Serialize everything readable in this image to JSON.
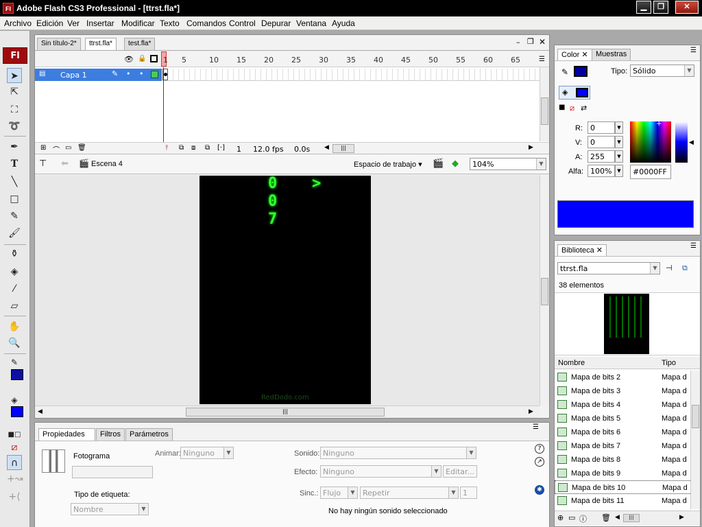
{
  "window": {
    "title": "Adobe Flash CS3 Professional - [ttrst.fla*]",
    "app_icon": "Fl"
  },
  "menu": [
    "Archivo",
    "Edición",
    "Ver",
    "Insertar",
    "Modificar",
    "Texto",
    "Comandos",
    "Control",
    "Depurar",
    "Ventana",
    "Ayuda"
  ],
  "doc_tabs": [
    "Sin título-2*",
    "ttrst.fla*",
    "test.fla*"
  ],
  "timeline": {
    "frame_numbers": [
      "1",
      "5",
      "10",
      "15",
      "20",
      "25",
      "30",
      "35",
      "40",
      "45",
      "50",
      "55",
      "60",
      "65"
    ],
    "layer_name": "Capa 1",
    "current_frame": "1",
    "fps": "12.0 fps",
    "time": "0.0s"
  },
  "editbar": {
    "scene": "Escena 4",
    "workspace": "Espacio de trabajo",
    "zoom": "104%"
  },
  "stage": {
    "glyphs": [
      "0",
      "0",
      "7",
      ">"
    ],
    "watermark": "RedDodo.com",
    "background": "#000000"
  },
  "props": {
    "tabs": [
      "Propiedades",
      "Filtros",
      "Parámetros"
    ],
    "frame_label": "Fotograma",
    "animate_label": "Animar:",
    "animate_value": "Ninguno",
    "label_type": "Tipo de etiqueta:",
    "label_type_value": "Nombre",
    "sound_label": "Sonido:",
    "sound_value": "Ninguno",
    "effect_label": "Efecto:",
    "effect_value": "Ninguno",
    "edit_button": "Editar...",
    "sync_label": "Sinc.:",
    "sync_value": "Flujo",
    "repeat_value": "Repetir",
    "repeat_count": "1",
    "no_sound": "No hay ningún sonido seleccionado"
  },
  "color": {
    "tabs": [
      "Color",
      "Muestras"
    ],
    "type_label": "Tipo:",
    "type_value": "Sólido",
    "r_label": "R:",
    "r": "0",
    "g_label": "V:",
    "g": "0",
    "b_label": "A:",
    "b": "255",
    "alpha_label": "Alfa:",
    "alpha": "100%",
    "hex": "#0000FF",
    "swatch": "#0000FF"
  },
  "library": {
    "tab": "Biblioteca",
    "file": "ttrst.fla",
    "count": "38 elementos",
    "col_name": "Nombre",
    "col_type": "Tipo",
    "items": [
      {
        "name": "Mapa de bits 2",
        "type": "Mapa d"
      },
      {
        "name": "Mapa de bits 3",
        "type": "Mapa d"
      },
      {
        "name": "Mapa de bits 4",
        "type": "Mapa d"
      },
      {
        "name": "Mapa de bits 5",
        "type": "Mapa d"
      },
      {
        "name": "Mapa de bits 6",
        "type": "Mapa d"
      },
      {
        "name": "Mapa de bits 7",
        "type": "Mapa d"
      },
      {
        "name": "Mapa de bits 8",
        "type": "Mapa d"
      },
      {
        "name": "Mapa de bits 9",
        "type": "Mapa d"
      },
      {
        "name": "Mapa de bits 10",
        "type": "Mapa d"
      },
      {
        "name": "Mapa de bits 11",
        "type": "Mapa d"
      }
    ]
  }
}
